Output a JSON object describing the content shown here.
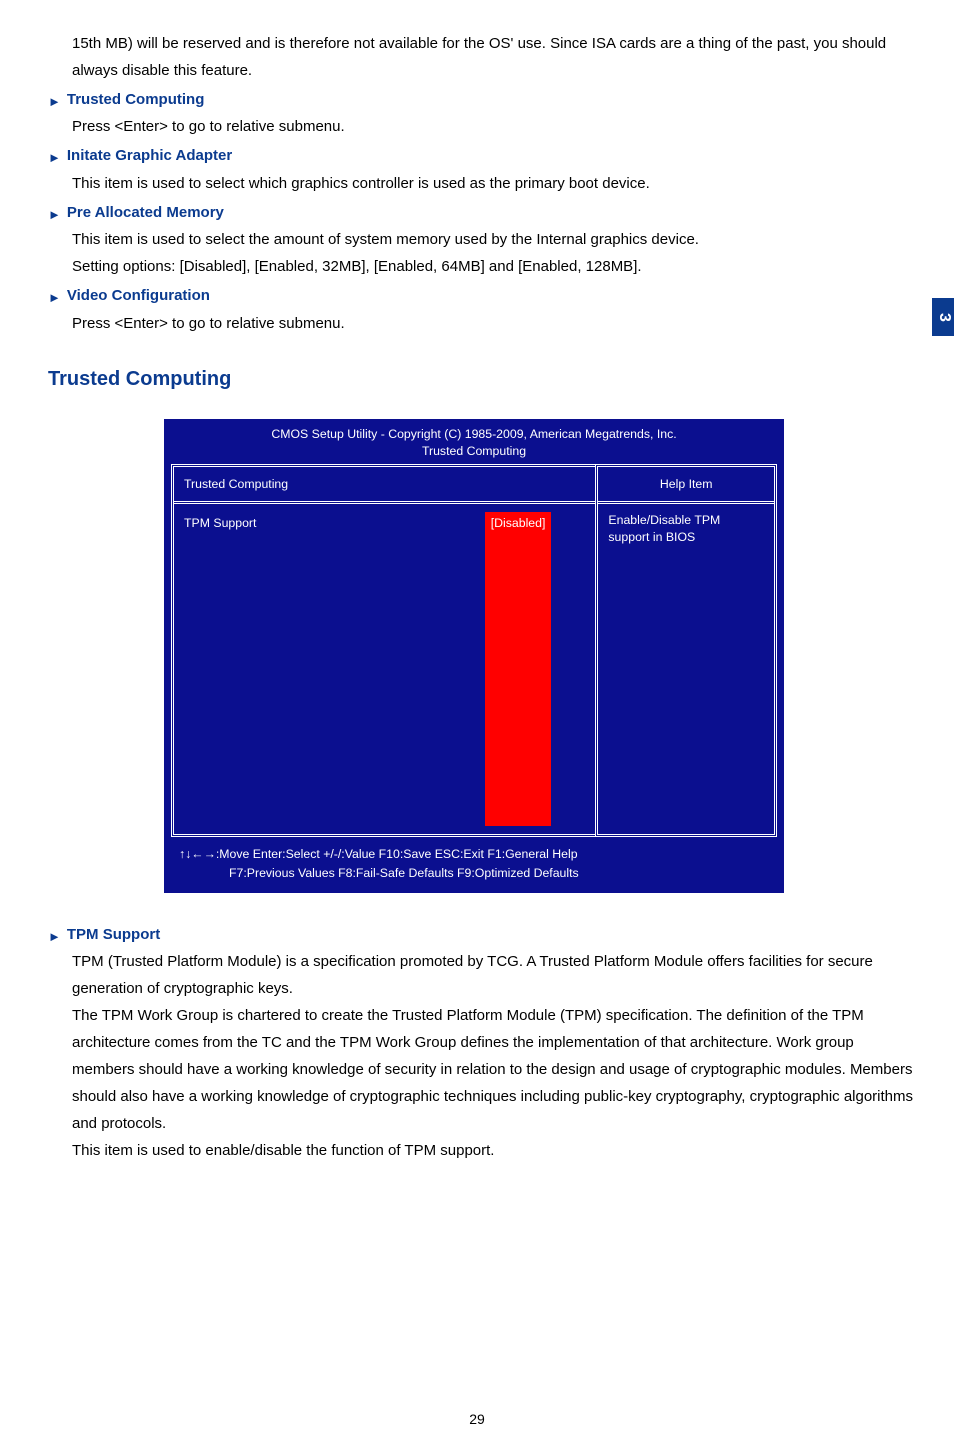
{
  "intro_para": "15th MB) will be reserved and is therefore not available for the OS' use. Since ISA cards are a thing of the past, you should always disable this feature.",
  "items": {
    "trusted_computing": {
      "title": "Trusted Computing",
      "desc": "Press <Enter> to go to relative submenu."
    },
    "initate_graphic": {
      "title": "Initate Graphic Adapter",
      "desc": "This item is used to select which graphics controller is used as the primary boot device."
    },
    "pre_alloc": {
      "title": "Pre Allocated Memory",
      "desc1": "This item is used to select the amount of system memory used by the Internal graphics device.",
      "desc2": "Setting options: [Disabled], [Enabled, 32MB], [Enabled, 64MB] and [Enabled, 128MB]."
    },
    "video_config": {
      "title": "Video Configuration",
      "desc": "Press <Enter> to go to relative submenu."
    }
  },
  "section_heading": "Trusted Computing",
  "bios": {
    "header_line1": "CMOS Setup Utility - Copyright (C) 1985-2009, American Megatrends, Inc.",
    "header_line2": "Trusted Computing",
    "left_top": "Trusted Computing",
    "tpm_label": "TPM Support",
    "tpm_value": "[Disabled]",
    "right_top": "Help Item",
    "right_body": "Enable/Disable TPM support in BIOS",
    "footer_line1": "↑↓←→:Move  Enter:Select    +/-/:Value    F10:Save   ESC:Exit      F1:General Help",
    "footer_line2": "F7:Previous Values        F8:Fail-Safe Defaults         F9:Optimized Defaults"
  },
  "tpm_support": {
    "title": "TPM Support",
    "p1": "TPM (Trusted Platform Module) is a specification promoted by TCG. A Trusted Platform Module offers facilities for secure generation of cryptographic keys.",
    "p2": "The TPM Work Group is chartered to create the Trusted Platform Module (TPM) specification. The definition of the TPM architecture comes from the TC and the TPM Work Group defines the implementation of that architecture. Work group members should have a working knowledge of security in relation to the design and usage of cryptographic modules. Members should also have a working knowledge of cryptographic techniques including public-key cryptography, cryptographic algorithms and protocols.",
    "p3": "This item is used to enable/disable the function of TPM support."
  },
  "side_tab": "3",
  "page_number": "29"
}
